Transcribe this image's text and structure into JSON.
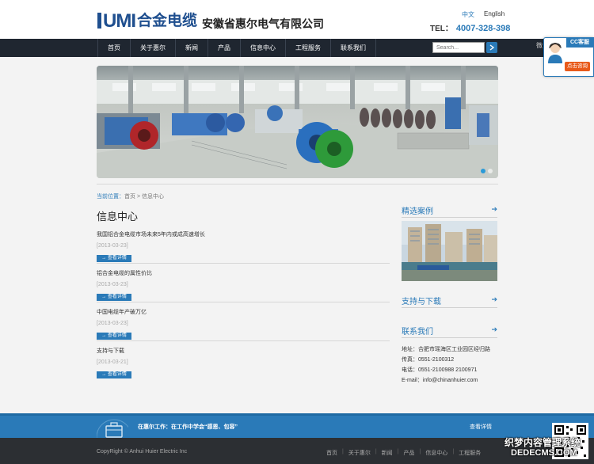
{
  "header": {
    "logo_text": "UMI",
    "logo_cn": "合金电缆",
    "company": "安徽省惠尔电气有限公司",
    "lang_cn": "中文",
    "lang_en": "English",
    "tel_label": "TEL：",
    "tel": "4007-328-398"
  },
  "nav": {
    "items": [
      "首页",
      "关于惠尔",
      "新闻",
      "产品",
      "信息中心",
      "工程服务",
      "联系我们"
    ],
    "search_placeholder": "Search...",
    "edge_text": "微"
  },
  "cs_widget": {
    "title": "CC客服",
    "button": "点击咨询"
  },
  "breadcrumb": {
    "label": "当前位置：",
    "path": "首页 > 信息中心"
  },
  "main": {
    "title": "信息中心",
    "news": [
      {
        "title": "我国铝合金电缆市场未来5年内或成高速增长",
        "date": "[2013-03-23]",
        "btn": "查看详情"
      },
      {
        "title": "铝合金电缆的属性价比",
        "date": "[2013-03-23]",
        "btn": "查看详情"
      },
      {
        "title": "中国电缆年产破万亿",
        "date": "[2013-03-23]",
        "btn": "查看详情"
      },
      {
        "title": "支持与下载",
        "date": "[2013-03-21]",
        "btn": "查看详情"
      }
    ]
  },
  "sidebar": {
    "cases_title": "精选案例",
    "support_title": "支持与下载",
    "contact_title": "联系我们",
    "contact": [
      "地址：合肥市瑶海区工业园区经归路",
      "传真：0551-2100312",
      "电话：0551-2100988 2100971",
      "E-mail：info@chinanhuier.com"
    ]
  },
  "footer": {
    "slogan": "在惠尔工作：在工作中学会“感恩、包容”",
    "more": "查看详情",
    "copyright": "CopyRight © Anhui Huier Electric Inc",
    "links": [
      "首页",
      "关于惠尔",
      "新闻",
      "产品",
      "信息中心",
      "工程服务"
    ],
    "watermark1": "织梦内容管理系统",
    "watermark2": "DEDECMS.COM"
  }
}
